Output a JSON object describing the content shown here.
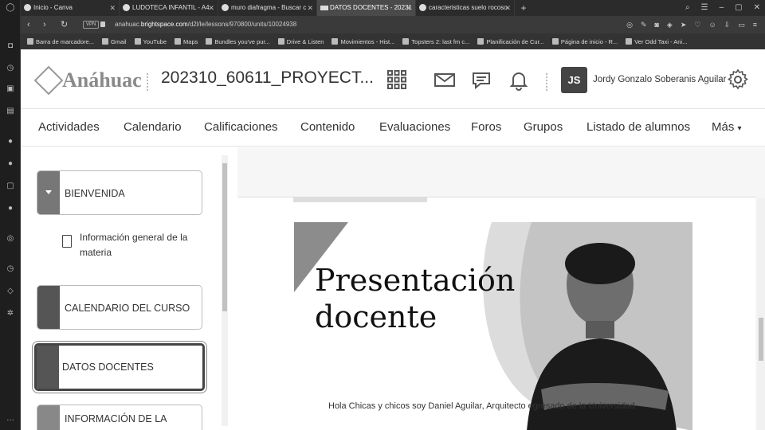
{
  "tabs": [
    {
      "title": "Inicio - Canva",
      "active": false
    },
    {
      "title": "LUDOTECA INFANTIL - A4",
      "active": false
    },
    {
      "title": "muro diafragma - Buscar c",
      "active": false
    },
    {
      "title": "DATOS DOCENTES - 20231",
      "active": true
    },
    {
      "title": "caracteristicas suelo rocoso",
      "active": false
    }
  ],
  "address": {
    "vpn": "VPN",
    "url_prefix": "anahuac.",
    "url_domain": "brightspace.com",
    "url_path": "/d2l/le/lessons/970800/units/10024938"
  },
  "bookmarks": [
    "Barra de marcadore...",
    "Gmail",
    "YouTube",
    "Maps",
    "Bundles you've pur...",
    "Drive & Listen",
    "Movimientos - Hist...",
    "Topsters 2: last fm c...",
    "Planificación de Cur...",
    "Página de inicio - R...",
    "Ver Odd Taxi - Ani..."
  ],
  "header": {
    "logo_text": "Anáhuac",
    "course_title": "202310_60611_PROYECT...",
    "avatar_initials": "JS",
    "user_name": "Jordy Gonzalo Soberanis Aguilar"
  },
  "nav": [
    "Actividades",
    "Calendario",
    "Calificaciones",
    "Contenido",
    "Evaluaciones",
    "Foros",
    "Grupos",
    "Listado de alumnos",
    "Más"
  ],
  "units": [
    {
      "label": "BIENVENIDA"
    },
    {
      "label": "CALENDARIO DEL CURSO"
    },
    {
      "label": "DATOS DOCENTES"
    },
    {
      "label": "INFORMACIÓN DE LA"
    }
  ],
  "topic": {
    "label": "Información general de la materia"
  },
  "content": {
    "hero_title_1": "Presentación",
    "hero_title_2": "docente",
    "intro": "Hola Chicas y chicos soy Daniel Aguilar, Arquitecto egresado de la Universidad"
  }
}
